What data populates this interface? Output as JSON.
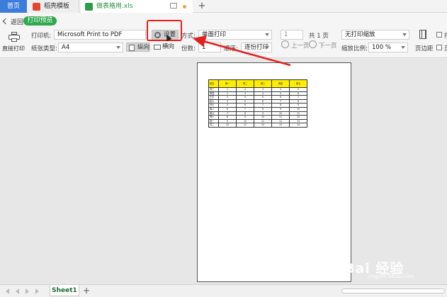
{
  "tabs": {
    "home": "首页",
    "template": "稻壳模板",
    "file": "做表格用.xls",
    "add": "+"
  },
  "toolbar": {
    "back": "返回",
    "preview_badge": "打印预览",
    "direct_print": "直接打印",
    "printer_label": "打印机:",
    "printer_value": "Microsoft Print to PDF",
    "settings": "设置",
    "mode_label": "方式:",
    "mode_value": "单面打印",
    "page_input": "1",
    "page_total": "共 1 页",
    "scale_mode": "无打印缩放",
    "paper_label": "纸张类型:",
    "paper_value": "A4",
    "portrait": "纵向",
    "landscape": "横向",
    "copies_label": "份数:",
    "copies_value": "1",
    "order_label": "顺序:",
    "order_value": "逐份打印",
    "prev_page": "上一页",
    "next_page": "下一页",
    "zoom_label": "缩放比例:",
    "zoom_value": "100 %",
    "margins": "页边距",
    "print_gridlines": "打",
    "print_other": "页"
  },
  "sheet_table": {
    "headers": [
      "姓名",
      "周一",
      "周二",
      "周三",
      "周四",
      "周五"
    ],
    "rows": [
      [
        "张三",
        "1",
        "2",
        "3",
        "4",
        "5"
      ],
      [
        "李四",
        "2",
        "3",
        "4",
        "5",
        "6"
      ],
      [
        "王五",
        "3",
        "4",
        "5",
        "6",
        "7"
      ],
      [
        "赵六",
        "4",
        "5",
        "6",
        "7",
        "8"
      ],
      [
        "孙七",
        "5",
        "6",
        "7",
        "8",
        "9"
      ],
      [
        "周八",
        "6",
        "7",
        "8",
        "9",
        "10"
      ],
      [
        "吴九",
        "7",
        "8",
        "9",
        "10",
        "11"
      ],
      [
        "郑十",
        "8",
        "9",
        "10",
        "11",
        "12"
      ],
      [
        "钱一",
        "9",
        "10",
        "11",
        "12",
        "13"
      ],
      [
        "冯二",
        "10",
        "11",
        "12",
        "13",
        "14"
      ]
    ]
  },
  "bottombar": {
    "sheet_name": "Sheet1",
    "add": "+"
  },
  "watermark": {
    "text": "Bai 经验",
    "sub": "jingyan.baidu.com"
  },
  "colors": {
    "accent": "#3c7ddb",
    "preview_green": "#2fa84f",
    "highlight_red": "#e3201f",
    "header_yellow": "#ffee00"
  }
}
